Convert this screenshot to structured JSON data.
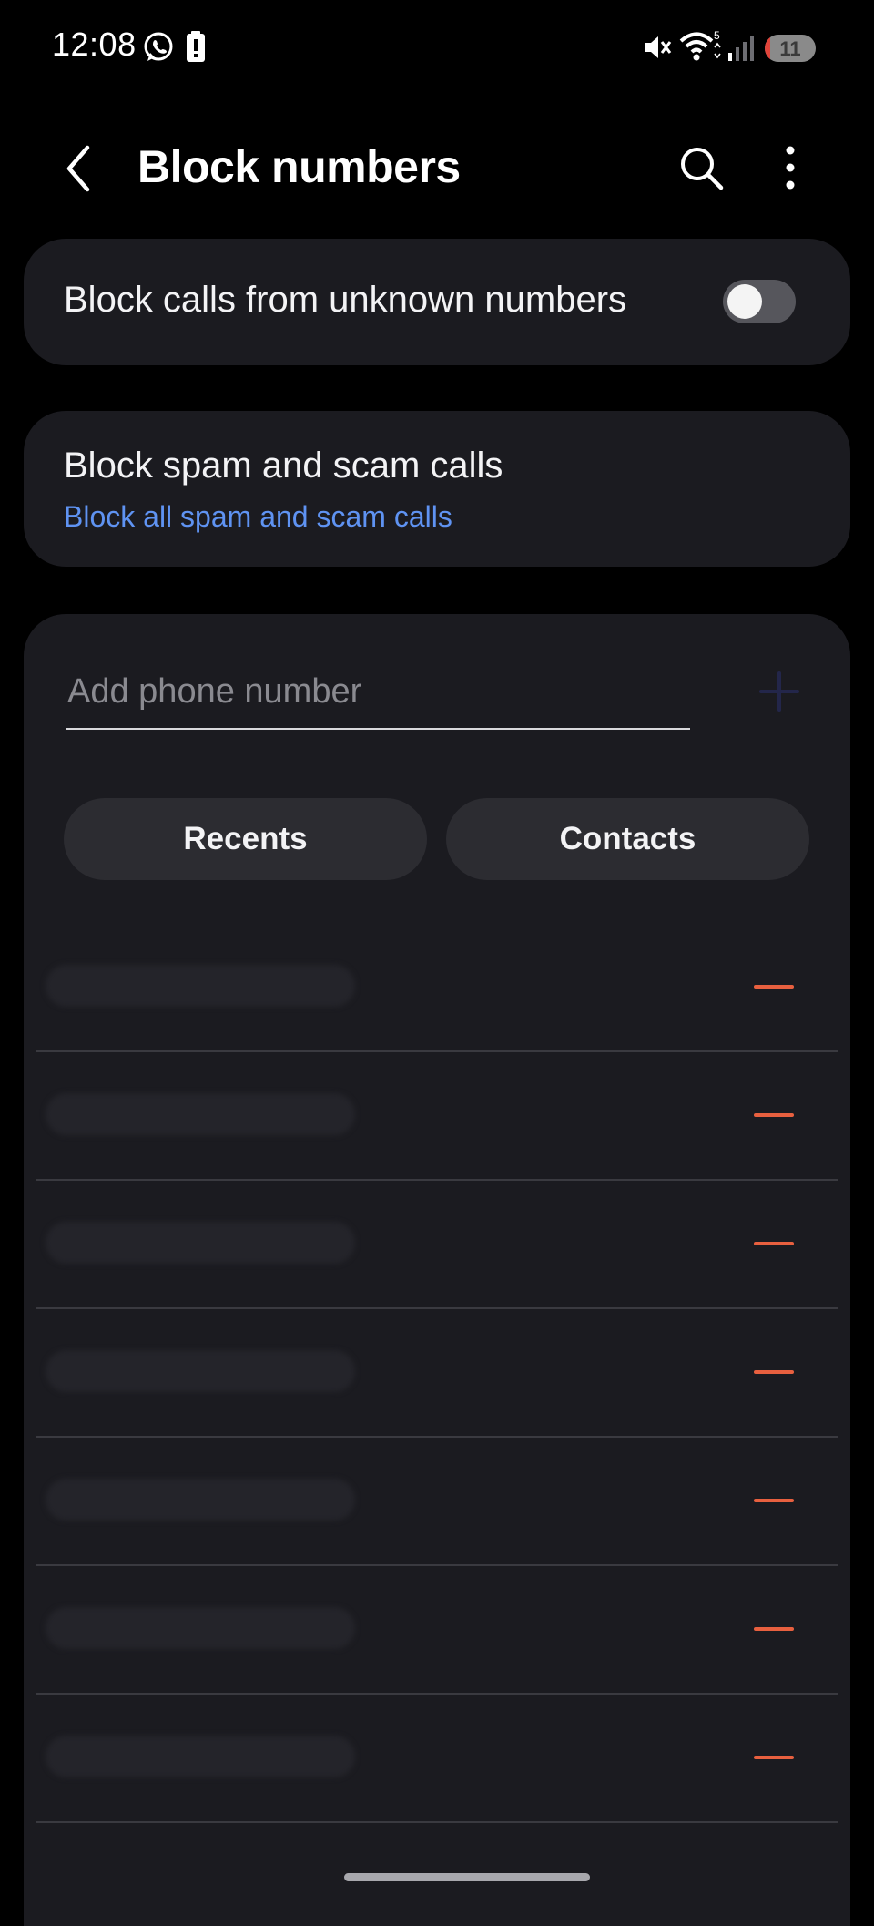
{
  "status_bar": {
    "time": "12:08",
    "battery_level": "11",
    "battery_fraction": 0.11,
    "icons": [
      "whatsapp-icon",
      "battery-alert-icon",
      "mute-icon",
      "wifi-icon",
      "signal-icon"
    ]
  },
  "header": {
    "title": "Block numbers",
    "icons": [
      "back-arrow-icon",
      "search-icon",
      "more-vert-icon"
    ]
  },
  "settings": {
    "unknown_numbers": {
      "label": "Block calls from unknown numbers",
      "enabled": false
    },
    "spam_calls": {
      "label": "Block spam and scam calls",
      "value": "Block all spam and scam calls"
    }
  },
  "add_number": {
    "placeholder": "Add phone number",
    "value": ""
  },
  "buttons": {
    "recents": "Recents",
    "contacts": "Contacts"
  },
  "blocked_numbers_count": 7,
  "colors": {
    "background": "#000000",
    "card": "#1b1b20",
    "accent_blue": "#5f93f2",
    "remove_red": "#e8603f",
    "pill": "#2c2c31"
  }
}
